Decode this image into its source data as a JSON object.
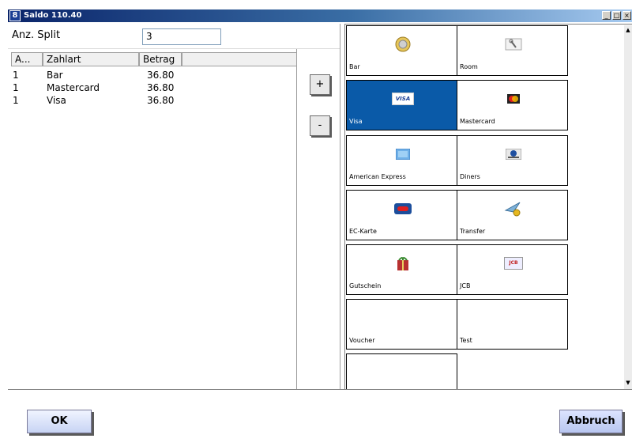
{
  "window": {
    "title": "Saldo 110.40",
    "app_icon": "8"
  },
  "split": {
    "label": "Anz. Split",
    "value": "3"
  },
  "table": {
    "columns": [
      "A...",
      "Zahlart",
      "Betrag"
    ],
    "rows": [
      [
        "1",
        "Bar",
        "36.80"
      ],
      [
        "1",
        "Mastercard",
        "36.80"
      ],
      [
        "1",
        "Visa",
        "36.80"
      ]
    ]
  },
  "controls": {
    "plus": "+",
    "minus": "-"
  },
  "payment_methods": [
    {
      "label": "Bar",
      "icon": "coin-icon",
      "selected": false
    },
    {
      "label": "Room",
      "icon": "key-icon",
      "selected": false
    },
    {
      "label": "Visa",
      "icon": "visa-card-icon",
      "selected": true
    },
    {
      "label": "Mastercard",
      "icon": "mastercard-icon",
      "selected": false
    },
    {
      "label": "American Express",
      "icon": "amex-card-icon",
      "selected": false
    },
    {
      "label": "Diners",
      "icon": "diners-card-icon",
      "selected": false
    },
    {
      "label": "EC-Karte",
      "icon": "ec-card-icon",
      "selected": false
    },
    {
      "label": "Transfer",
      "icon": "transfer-icon",
      "selected": false
    },
    {
      "label": "Gutschein",
      "icon": "gift-icon",
      "selected": false
    },
    {
      "label": "JCB",
      "icon": "jcb-card-icon",
      "selected": false
    },
    {
      "label": "Voucher",
      "icon": "",
      "selected": false
    },
    {
      "label": "Test",
      "icon": "",
      "selected": false
    },
    {
      "label": "",
      "icon": "",
      "selected": false
    }
  ],
  "icon_texts": {
    "visa": "VISA",
    "mastercard": "MC",
    "jcb": "JCB"
  },
  "buttons": {
    "ok": "OK",
    "cancel": "Abbruch"
  },
  "colors": {
    "selected_tile": "#0a5aa8",
    "title_bar": "#0a246a"
  }
}
